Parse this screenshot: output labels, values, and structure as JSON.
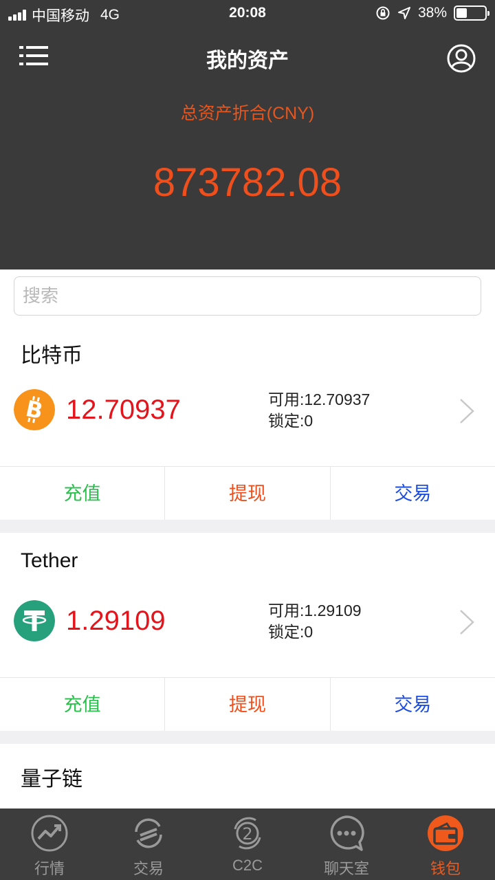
{
  "status_bar": {
    "carrier": "中国移动",
    "network": "4G",
    "time": "20:08",
    "battery": "38%",
    "battery_level": 0.38
  },
  "nav": {
    "title": "我的资产",
    "menu_icon": "menu-icon",
    "user_icon": "user-circle-icon"
  },
  "summary": {
    "label": "总资产折合(CNY)",
    "value": "873782.08"
  },
  "search": {
    "placeholder": "搜索",
    "value": ""
  },
  "assets": [
    {
      "name": "比特币",
      "icon": "bitcoin-icon",
      "icon_color": "#f7931a",
      "amount": "12.70937",
      "available": "可用:12.70937",
      "locked": "锁定:0",
      "actions": {
        "deposit": "充值",
        "withdraw": "提现",
        "trade": "交易"
      }
    },
    {
      "name": "Tether",
      "icon": "tether-icon",
      "icon_color": "#26a17b",
      "amount": "1.29109",
      "available": "可用:1.29109",
      "locked": "锁定:0",
      "actions": {
        "deposit": "充值",
        "withdraw": "提现",
        "trade": "交易"
      }
    },
    {
      "name": "量子链"
    }
  ],
  "tabbar": {
    "items": [
      {
        "label": "行情",
        "icon": "market-trend-icon"
      },
      {
        "label": "交易",
        "icon": "exchange-icon"
      },
      {
        "label": "C2C",
        "icon": "c2c-icon"
      },
      {
        "label": "聊天室",
        "icon": "chat-icon"
      },
      {
        "label": "钱包",
        "icon": "wallet-icon",
        "active": true
      }
    ]
  },
  "colors": {
    "header_bg": "#3a3a3a",
    "accent": "#ef4f1c",
    "amount_red": "#e4141c",
    "deposit_green": "#2bc04e",
    "trade_blue": "#1d4de0",
    "tabbar_bg": "#3d3d3d"
  }
}
